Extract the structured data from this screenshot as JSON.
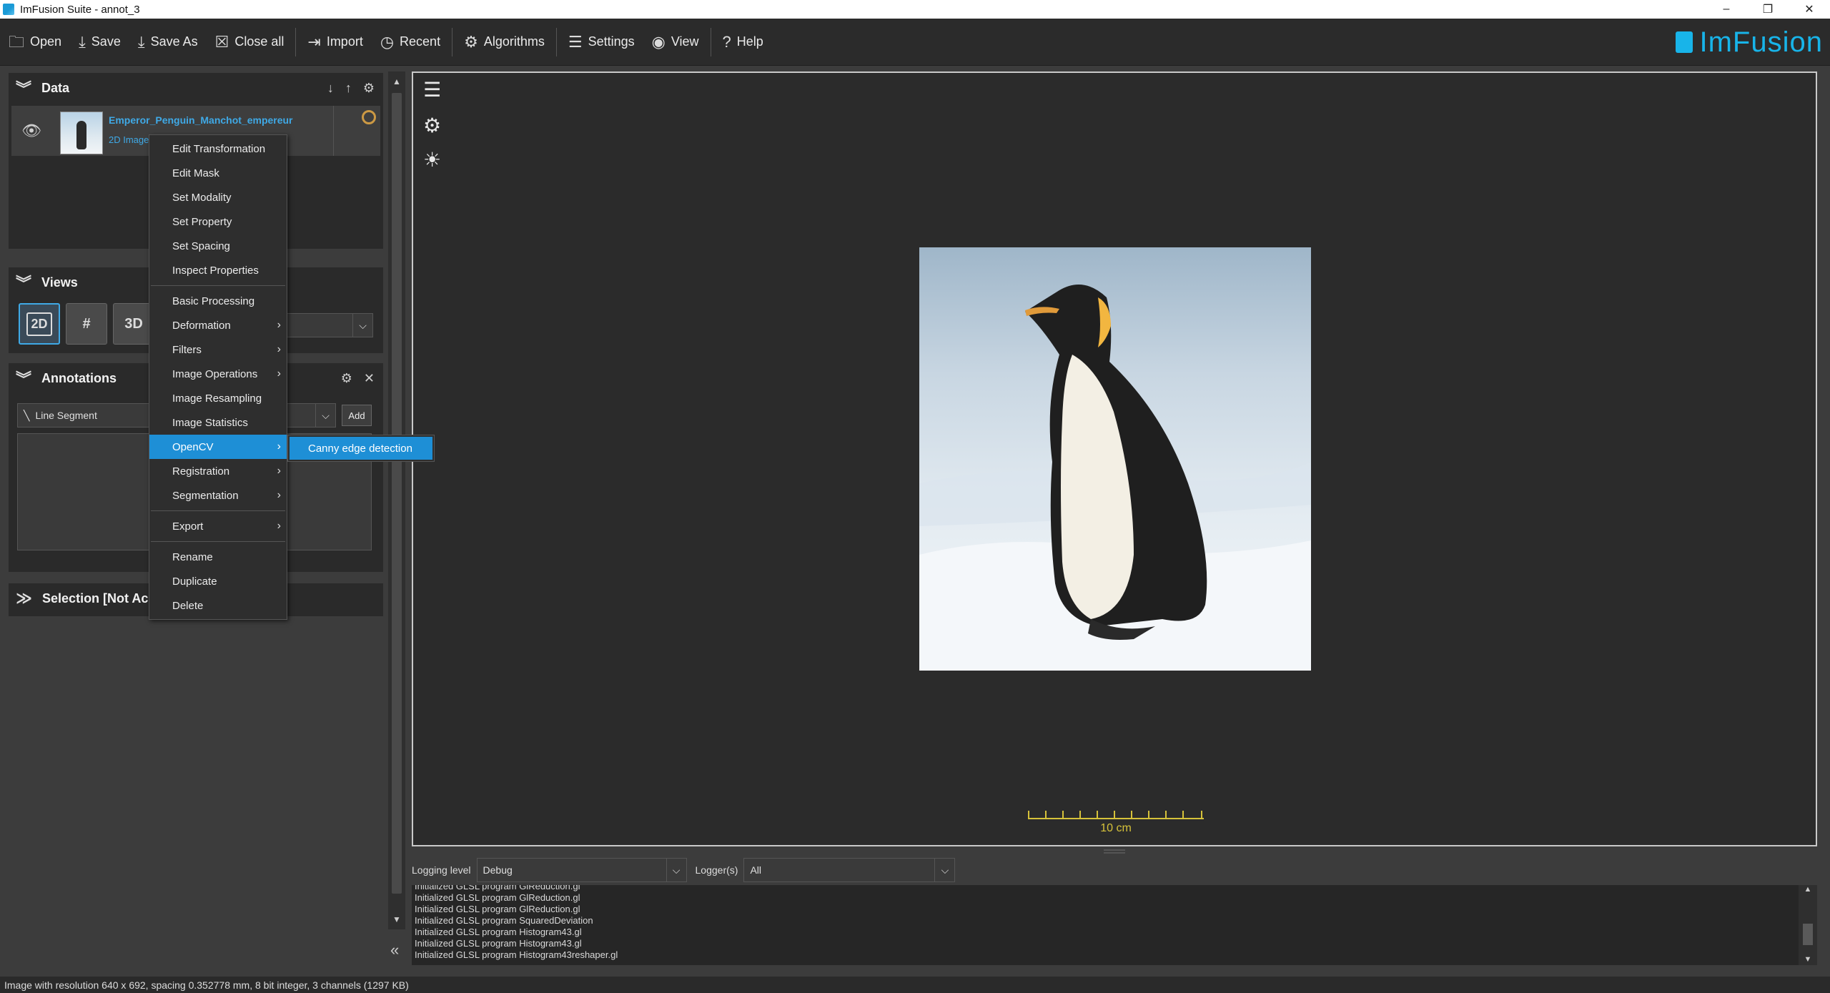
{
  "window": {
    "title": "ImFusion Suite - annot_3",
    "min": "–",
    "max": "❐",
    "close": "✕"
  },
  "toolbar": {
    "items": [
      {
        "label": "Open",
        "icon": "folder-icon",
        "glyph": "🗀"
      },
      {
        "label": "Save",
        "icon": "download-icon",
        "glyph": "⤓"
      },
      {
        "label": "Save As",
        "icon": "save-as-icon",
        "glyph": "⤓"
      },
      {
        "label": "Close all",
        "icon": "close-all-icon",
        "glyph": "☒"
      },
      {
        "label": "Import",
        "icon": "import-icon",
        "glyph": "⇥"
      },
      {
        "label": "Recent",
        "icon": "clock-icon",
        "glyph": "◷"
      },
      {
        "label": "Algorithms",
        "icon": "gears-icon",
        "glyph": "⚙"
      },
      {
        "label": "Settings",
        "icon": "sliders-icon",
        "glyph": "☰"
      },
      {
        "label": "View",
        "icon": "eye-icon",
        "glyph": "◉"
      },
      {
        "label": "Help",
        "icon": "help-icon",
        "glyph": "?"
      }
    ],
    "logo": "ImFusion"
  },
  "data_panel": {
    "title": "Data",
    "item": {
      "name": "Emperor_Penguin_Manchot_empereur",
      "type": "2D Image"
    }
  },
  "views_panel": {
    "title": "Views",
    "buttons": [
      "2D",
      "#",
      "3D"
    ]
  },
  "annotations_panel": {
    "title": "Annotations",
    "type_value": "Line Segment",
    "add_label": "Add"
  },
  "selection_panel": {
    "title": "Selection [Not Ac"
  },
  "context_menu": {
    "items": [
      {
        "label": "Edit Transformation"
      },
      {
        "label": "Edit Mask"
      },
      {
        "label": "Set Modality"
      },
      {
        "label": "Set Property"
      },
      {
        "label": "Set Spacing"
      },
      {
        "label": "Inspect Properties"
      },
      {
        "label": "Basic Processing"
      },
      {
        "label": "Deformation",
        "submenu": true
      },
      {
        "label": "Filters",
        "submenu": true
      },
      {
        "label": "Image Operations",
        "submenu": true
      },
      {
        "label": "Image Resampling"
      },
      {
        "label": "Image Statistics"
      },
      {
        "label": "OpenCV",
        "submenu": true,
        "highlighted": true
      },
      {
        "label": "Registration",
        "submenu": true
      },
      {
        "label": "Segmentation",
        "submenu": true
      },
      {
        "label": "Export",
        "submenu": true
      },
      {
        "label": "Rename"
      },
      {
        "label": "Duplicate"
      },
      {
        "label": "Delete"
      }
    ],
    "submenu_item": "Canny edge detection"
  },
  "viewport": {
    "scale_label": "10 cm"
  },
  "logging": {
    "level_label": "Logging level",
    "level_value": "Debug",
    "loggers_label": "Logger(s)",
    "loggers_value": "All",
    "lines": [
      "Initialized GLSL program GlReduction.gl",
      "Initialized GLSL program GlReduction.gl",
      "Initialized GLSL program GlReduction.gl",
      "Initialized GLSL program SquaredDeviation",
      "Initialized GLSL program Histogram43.gl",
      "Initialized GLSL program Histogram43.gl",
      "Initialized GLSL program Histogram43reshaper.gl"
    ]
  },
  "status_bar": "Image with resolution 640 x 692, spacing 0.352778 mm, 8 bit integer, 3 channels (1297 KB)",
  "colors": {
    "accent": "#1e8fd6",
    "link": "#3fa9e6",
    "brand": "#18b4e9",
    "scale": "#d6c23a"
  }
}
